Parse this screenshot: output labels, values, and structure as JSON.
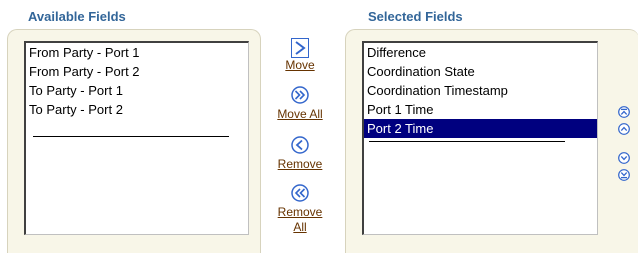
{
  "available": {
    "heading": "Available Fields",
    "items": [
      "From Party - Port 1",
      "From Party - Port 2",
      "To Party - Port 1",
      "To Party - Port 2"
    ]
  },
  "selected": {
    "heading": "Selected Fields",
    "items": [
      "Difference",
      "Coordination State",
      "Coordination Timestamp",
      "Port 1 Time",
      "Port 2 Time"
    ],
    "selected_item": "Port 2 Time"
  },
  "shuttle": {
    "move_label": "Move",
    "move_all_label": "Move All",
    "remove_label": "Remove",
    "remove_all_label_line1": "Remove",
    "remove_all_label_line2": "All"
  },
  "reorder": {
    "icons": [
      "move-to-top-icon",
      "move-up-icon",
      "move-down-icon",
      "move-to-bottom-icon"
    ]
  },
  "colors": {
    "heading": "#336699",
    "panel_bg": "#f8f6e8",
    "selection_bg": "#00007f",
    "button_blue": "#3366cc",
    "link_label": "#663300"
  }
}
